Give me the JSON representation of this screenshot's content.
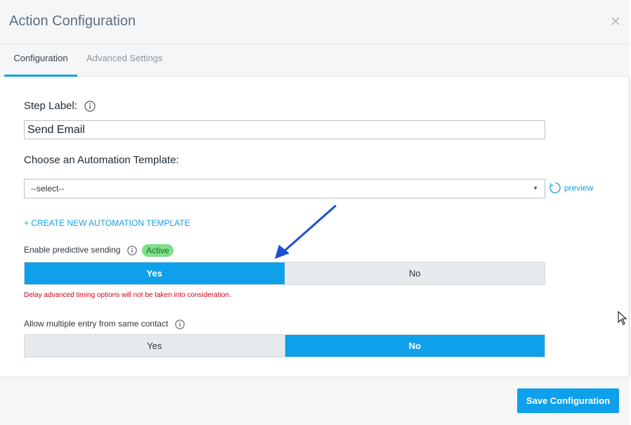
{
  "modal": {
    "title": "Action Configuration",
    "close_icon": "close-icon"
  },
  "tabs": [
    {
      "label": "Configuration",
      "active": true
    },
    {
      "label": "Advanced Settings",
      "active": false
    }
  ],
  "step_label": {
    "label": "Step Label:",
    "value": "Send Email"
  },
  "template": {
    "label": "Choose an Automation Template:",
    "selected": "--select--",
    "preview_label": "preview",
    "create_link": "+ CREATE NEW AUTOMATION TEMPLATE"
  },
  "predictive": {
    "label": "Enable predictive sending",
    "badge": "Active",
    "options": [
      "Yes",
      "No"
    ],
    "selected": "Yes",
    "warning": "Delay advanced timing options will not be taken into consideration."
  },
  "multiple_entry": {
    "label": "Allow multiple entry from same contact",
    "options": [
      "Yes",
      "No"
    ],
    "selected": "No"
  },
  "footer": {
    "save_label": "Save Configuration"
  },
  "colors": {
    "accent": "#0ea0ea",
    "badge_bg": "#7ee08a",
    "warning": "#d6001c",
    "link": "#1ba0e2"
  }
}
